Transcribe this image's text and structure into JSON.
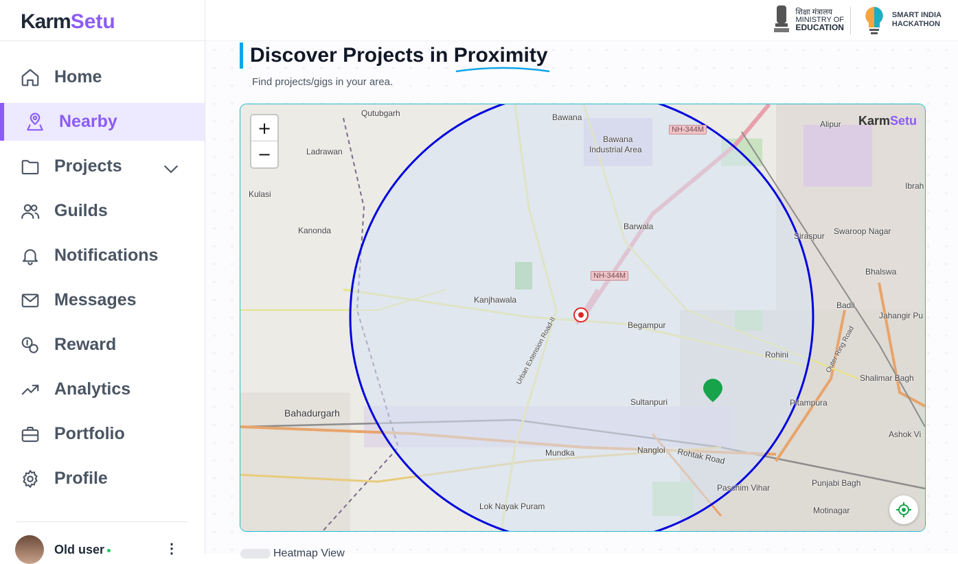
{
  "app": {
    "logo_k": "Karm",
    "logo_s": "Setu"
  },
  "sidebar": {
    "items": [
      {
        "label": "Home",
        "icon": "home-icon"
      },
      {
        "label": "Nearby",
        "icon": "map-pin-icon",
        "active": true
      },
      {
        "label": "Projects",
        "icon": "folder-icon"
      },
      {
        "label": "Guilds",
        "icon": "users-icon"
      },
      {
        "label": "Notifications",
        "icon": "bell-icon"
      },
      {
        "label": "Messages",
        "icon": "mail-icon"
      },
      {
        "label": "Reward",
        "icon": "reward-icon"
      },
      {
        "label": "Analytics",
        "icon": "trending-icon"
      },
      {
        "label": "Portfolio",
        "icon": "briefcase-icon"
      },
      {
        "label": "Profile",
        "icon": "gear-icon"
      }
    ],
    "user": {
      "name": "Old user"
    }
  },
  "header": {
    "moe_hindi": "शिक्षा मंत्रालय",
    "moe_line1": "MINISTRY OF",
    "moe_line2": "EDUCATION",
    "sih_line1": "SMART INDIA",
    "sih_line2": "HACKATHON"
  },
  "main": {
    "title": "Discover Projects in Proximity",
    "subtitle": "Find projects/gigs in your area.",
    "toggle_label": "Heatmap View"
  },
  "map": {
    "zoom_in": "+",
    "zoom_out": "−",
    "watermark_k": "Karm",
    "watermark_s": "Setu",
    "radius_color": "#0000dd",
    "user_marker_color": "#dc2626",
    "project_marker_color": "#16a34a",
    "places": {
      "qutubgarh": "Qutubgarh",
      "bawana": "Bawana",
      "bawana_ind": "Bawana",
      "bawana_ind2": "Industrial Area",
      "alipur": "Alipur",
      "ladrawan": "Ladrawan",
      "ibrah": "Ibrah",
      "kulasi": "Kulasi",
      "kanonda": "Kanonda",
      "barwala": "Barwala",
      "siraspur": "Siraspur",
      "swaroop": "Swaroop Nagar",
      "bhalswa": "Bhalswa",
      "kanjhawala": "Kanjhawala",
      "badli": "Badli",
      "jahangir": "Jahangir Pu",
      "begampur": "Begampur",
      "rohini": "Rohini",
      "shalimar": "Shalimar Bagh",
      "sultanpuri": "Sultanpuri",
      "pitampura": "Pitampura",
      "bahadurgarh": "Bahadurgarh",
      "ashok": "Ashok Vi",
      "mundka": "Mundka",
      "nangloi": "Nangloi",
      "rohtak_road": "Rohtak Road",
      "paschim": "Paschim Vihar",
      "punjabi": "Punjabi Bagh",
      "lok_nayak": "Lok Nayak Puram",
      "motinagar": "Motinagar",
      "urban_ext": "Urban Extension Road-II",
      "outer_ring": "Outer Ring Road",
      "nh1": "NH-344M",
      "nh2": "NH-344M"
    }
  }
}
